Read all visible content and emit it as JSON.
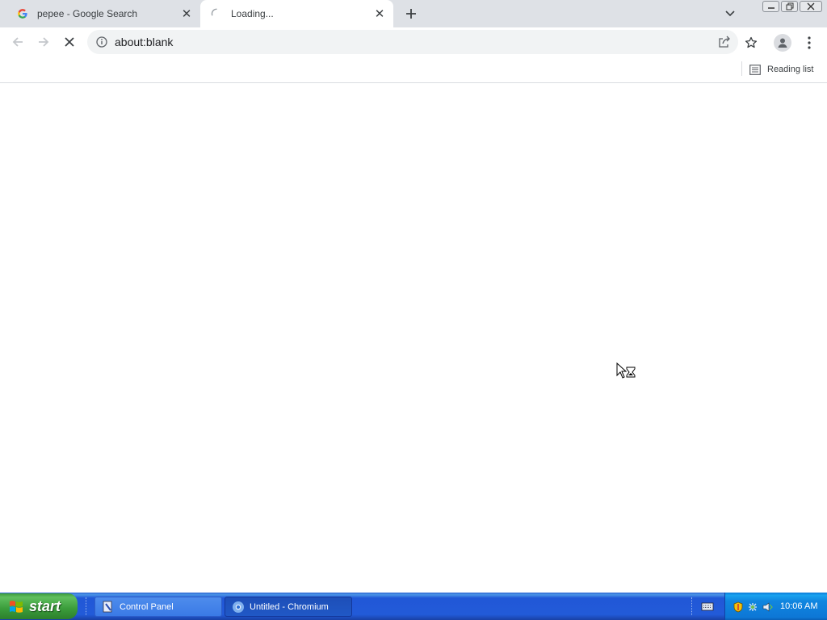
{
  "browser": {
    "tabs": [
      {
        "title": "pepee - Google Search",
        "favicon": "google-icon",
        "active": false
      },
      {
        "title": "Loading...",
        "favicon": "spinner-icon",
        "active": true
      }
    ],
    "address": {
      "url": "about:blank"
    },
    "bookmarks_bar": {
      "reading_list_label": "Reading list"
    }
  },
  "taskbar": {
    "start_label": "start",
    "items": [
      {
        "label": "Control Panel",
        "icon": "control-panel-icon"
      },
      {
        "label": "Untitled - Chromium",
        "icon": "chromium-icon"
      }
    ],
    "clock": "10:06 AM"
  },
  "colors": {
    "tabstrip": "#dee1e6",
    "omnibox": "#f1f3f4",
    "taskbar": "#225bd8",
    "start_button": "#3a9c3a",
    "tray": "#0d77d6"
  }
}
